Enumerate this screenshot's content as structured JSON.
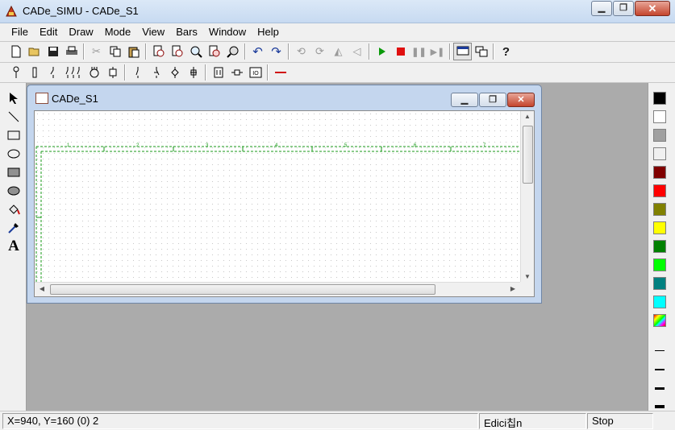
{
  "window": {
    "title": "CADe_SIMU - CADe_S1"
  },
  "menu": [
    "File",
    "Edit",
    "Draw",
    "Mode",
    "View",
    "Bars",
    "Window",
    "Help"
  ],
  "child_window": {
    "title": "CADe_S1"
  },
  "statusbar": {
    "coords": "X=940, Y=160 (0) 2",
    "mode": "Edici칩n",
    "sim_state": "Stop"
  },
  "canvas": {
    "border_numbers": [
      "1",
      "2",
      "3",
      "4",
      "5",
      "6",
      "7"
    ]
  },
  "colors": {
    "palette": [
      "#000000",
      "#ffffff",
      "#a0a0a0",
      "#f0f0f0",
      "#800000",
      "#ff0000",
      "#808000",
      "#ffff00",
      "#008000",
      "#00ff00",
      "#008080",
      "#00ffff"
    ],
    "grid_line": "#1a9a1a",
    "workspace": "#ababab"
  },
  "icons": {
    "toolbar1": [
      "new-file-icon",
      "open-folder-icon",
      "save-icon",
      "print-icon",
      "cut-icon",
      "copy-icon",
      "paste-icon",
      "zoom-in-icon",
      "zoom-out-icon",
      "zoom-area-icon",
      "zoom-fit-icon",
      "zoom-all-icon",
      "undo-icon",
      "redo-icon",
      "rotate-left-icon",
      "rotate-right-icon",
      "flip-horizontal-icon",
      "flip-vertical-icon",
      "play-icon",
      "stop-icon",
      "pause-icon",
      "step-icon",
      "window-mode-icon",
      "multi-window-icon",
      "help-icon"
    ],
    "toolbar2": [
      "power-supply-icon",
      "fuse-icon",
      "switch-icon",
      "contactor-icon",
      "motor-icon",
      "relay-icon",
      "contact-no-icon",
      "contact-nc-icon",
      "pushbutton-icon",
      "sensor-icon",
      "timer-icon",
      "coil-icon",
      "io-block-icon",
      "wire-icon"
    ],
    "left": [
      "pointer-icon",
      "line-tool-icon",
      "rectangle-tool-icon",
      "ellipse-tool-icon",
      "filled-rectangle-icon",
      "filled-ellipse-icon",
      "fill-bucket-icon",
      "eyedropper-icon",
      "text-tool-icon"
    ]
  }
}
